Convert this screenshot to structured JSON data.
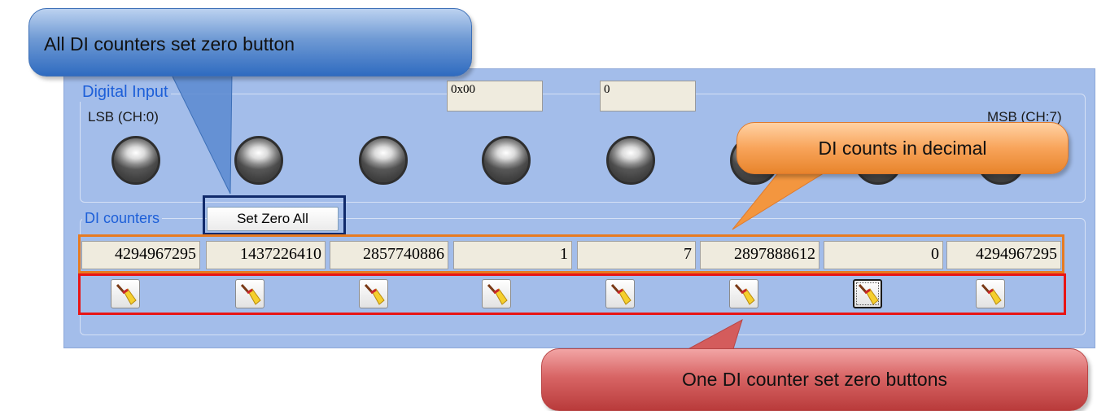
{
  "panel": {
    "di_group_title": "Digital Input",
    "lsb_label": "LSB (CH:0)",
    "msb_label": "MSB (CH:7)",
    "hex_value": "0x00",
    "decimal_value": "0",
    "led_count": 8
  },
  "counters": {
    "group_title": "DI counters",
    "set_zero_all_label": "Set Zero All",
    "values": [
      "4294967295",
      "1437226410",
      "2857740886",
      "1",
      "7",
      "2897888612",
      "0",
      "4294967295"
    ],
    "clear_icon": "broom-icon"
  },
  "callouts": {
    "set_zero_all": "All DI counters set zero button",
    "counts_decimal": "DI counts in decimal",
    "set_zero_each": "One DI counter set zero buttons"
  },
  "colors": {
    "panel_bg": "#a3bdea",
    "highlight_blue": "#102a6b",
    "highlight_orange": "#e77b21",
    "highlight_red": "#e81515"
  }
}
